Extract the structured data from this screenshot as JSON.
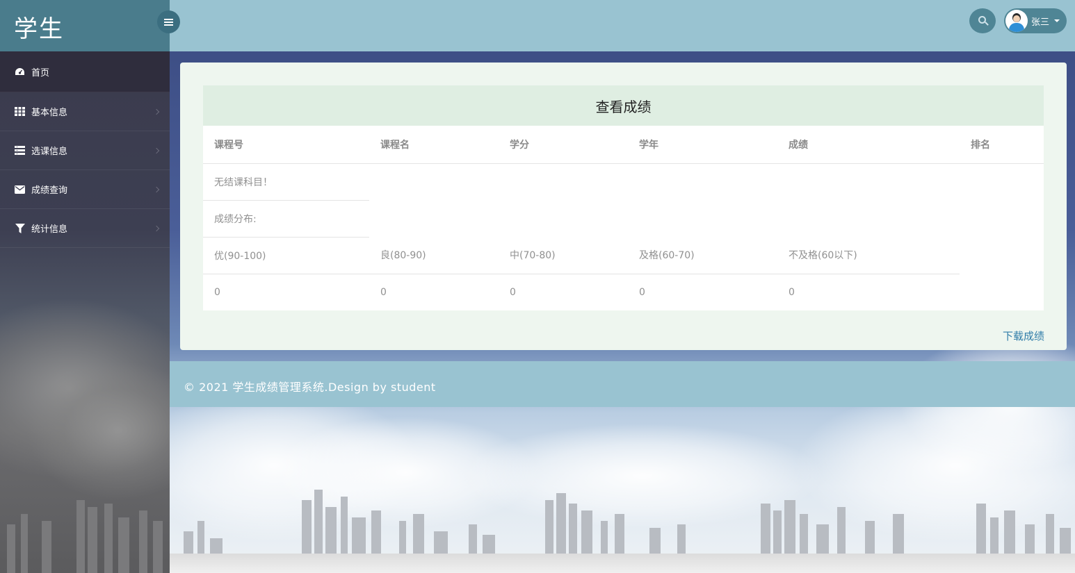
{
  "app": {
    "title": "学生"
  },
  "sidebar": {
    "items": [
      {
        "label": "首页",
        "icon": "dashboard-icon"
      },
      {
        "label": "基本信息",
        "icon": "grid-icon"
      },
      {
        "label": "选课信息",
        "icon": "list-icon"
      },
      {
        "label": "成绩查询",
        "icon": "envelope-icon"
      },
      {
        "label": "统计信息",
        "icon": "filter-icon"
      }
    ]
  },
  "header": {
    "user_name": "张三",
    "search_icon": "search-icon",
    "colors": {
      "header_bg": "#99c3d1",
      "button_bg": "#4f8595"
    }
  },
  "main": {
    "panel_title": "查看成绩",
    "columns": [
      "课程号",
      "课程名",
      "学分",
      "学年",
      "成绩",
      "排名"
    ],
    "empty_message": "无结课科目！",
    "distribution_label": "成绩分布:",
    "distribution": {
      "ranges": [
        "优(90-100)",
        "良(80-90)",
        "中(70-80)",
        "及格(60-70)",
        "不及格(60以下)"
      ],
      "counts": [
        "0",
        "0",
        "0",
        "0",
        "0"
      ]
    },
    "download_label": "下载成绩"
  },
  "footer": {
    "text": "© 2021 学生成绩管理系统.Design by student"
  }
}
